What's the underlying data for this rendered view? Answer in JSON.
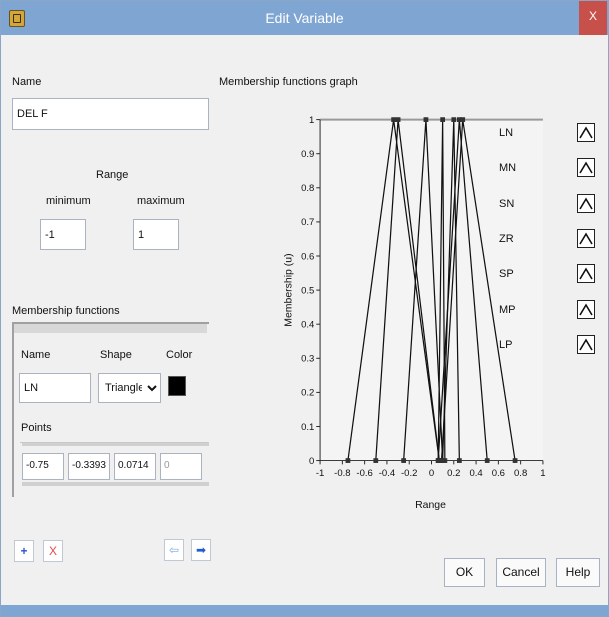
{
  "window": {
    "title": "Edit Variable",
    "close_label": "X"
  },
  "variable": {
    "name_label": "Name",
    "name_value": "DEL F",
    "range_label": "Range",
    "minimum_label": "minimum",
    "maximum_label": "maximum",
    "minimum_value": "-1",
    "maximum_value": "1"
  },
  "membership": {
    "section_label": "Membership functions",
    "name_label": "Name",
    "shape_label": "Shape",
    "color_label": "Color",
    "name_value": "LN",
    "shape_value": "Triangle",
    "points_label": "Points",
    "points": [
      "-0.75",
      "-0.3393",
      "0.0714",
      "0"
    ],
    "selected_color": "#000000"
  },
  "toolbar": {
    "add_label": "+",
    "delete_label": "X",
    "prev_label": "⇦",
    "next_label": "➡"
  },
  "graph": {
    "title": "Membership functions graph"
  },
  "mf_list": [
    "LN",
    "MN",
    "SN",
    "ZR",
    "SP",
    "MP",
    "LP"
  ],
  "chart_data": {
    "type": "line",
    "ylabel": "Membership (u)",
    "xlabel": "Range",
    "xlim": [
      -1,
      1
    ],
    "ylim": [
      0,
      1
    ],
    "x_ticks": [
      "-1",
      "-0.8",
      "-0.6",
      "-0.4",
      "-0.2",
      "0",
      "0.2",
      "0.4",
      "0.6",
      "0.8",
      "1"
    ],
    "y_ticks": [
      "0",
      "0.1",
      "0.2",
      "0.3",
      "0.4",
      "0.5",
      "0.6",
      "0.7",
      "0.8",
      "0.9",
      "1"
    ],
    "series": [
      {
        "name": "LN",
        "x": [
          -0.75,
          -0.34,
          0.07
        ],
        "y": [
          0,
          1,
          0
        ]
      },
      {
        "name": "MN",
        "x": [
          -0.5,
          -0.3,
          0.07
        ],
        "y": [
          0,
          1,
          0
        ]
      },
      {
        "name": "SN",
        "x": [
          -0.25,
          -0.05,
          0.1
        ],
        "y": [
          0,
          1,
          0
        ]
      },
      {
        "name": "ZR",
        "x": [
          0.06,
          0.1,
          0.12
        ],
        "y": [
          0,
          1,
          0
        ]
      },
      {
        "name": "SP",
        "x": [
          0.1,
          0.2,
          0.25
        ],
        "y": [
          0,
          1,
          0
        ]
      },
      {
        "name": "MP",
        "x": [
          0.06,
          0.25,
          0.5
        ],
        "y": [
          0,
          1,
          0
        ]
      },
      {
        "name": "LP",
        "x": [
          0.09,
          0.28,
          0.75
        ],
        "y": [
          0,
          1,
          0
        ]
      }
    ]
  },
  "buttons": {
    "ok": "OK",
    "cancel": "Cancel",
    "help": "Help"
  }
}
